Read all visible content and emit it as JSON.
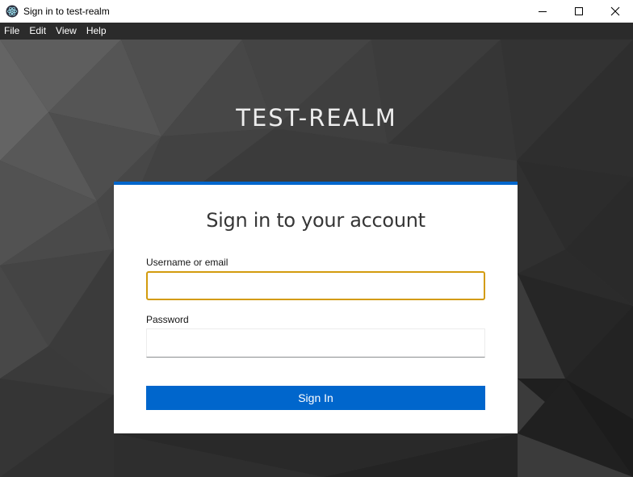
{
  "window": {
    "title": "Sign in to test-realm",
    "controls": {
      "minimize_icon": "minimize-icon",
      "maximize_icon": "maximize-icon",
      "close_icon": "close-icon"
    }
  },
  "menu": {
    "items": [
      {
        "label": "File"
      },
      {
        "label": "Edit"
      },
      {
        "label": "View"
      },
      {
        "label": "Help"
      }
    ]
  },
  "login": {
    "realm_name": "TEST-REALM",
    "heading": "Sign in to your account",
    "username": {
      "label": "Username or email",
      "value": ""
    },
    "password": {
      "label": "Password",
      "value": ""
    },
    "submit_label": "Sign In"
  },
  "colors": {
    "accent": "#0066cc",
    "focus_border": "#d39b0e",
    "background": "#3a3a3a",
    "menubar": "#2b2b2b"
  }
}
